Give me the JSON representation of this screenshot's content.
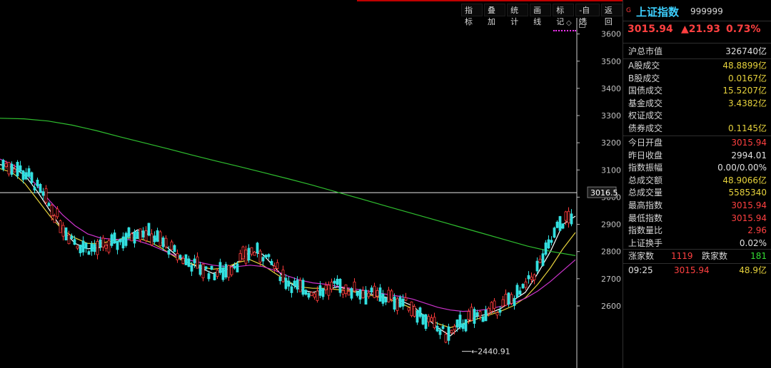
{
  "toolbar": [
    "指标",
    "叠加",
    "统计",
    "画线",
    "标记",
    "-自选",
    "返回"
  ],
  "chart_data": {
    "type": "candlestick",
    "y_axis_ticks": [
      3600,
      3500,
      3400,
      3300,
      3200,
      3100,
      3000,
      2900,
      2800,
      2700,
      2600
    ],
    "ylim": [
      2440,
      3620
    ],
    "crosshair_value": "3016.5",
    "low_annotation": "2440.91",
    "ma_series": [
      {
        "color": "#ffffff",
        "values": [
          3120,
          3110,
          3080,
          3020,
          2950,
          2880,
          2830,
          2810,
          2815,
          2830,
          2850,
          2880,
          2860,
          2830,
          2790,
          2760,
          2740,
          2720,
          2730,
          2760,
          2800,
          2790,
          2740,
          2690,
          2660,
          2650,
          2660,
          2670,
          2660,
          2650,
          2640,
          2630,
          2620,
          2600,
          2560,
          2520,
          2490,
          2530,
          2560,
          2570,
          2590,
          2620,
          2650,
          2720,
          2800,
          2900,
          2930
        ]
      },
      {
        "color": "#e6d23c",
        "values": [
          3105,
          3090,
          3050,
          2990,
          2930,
          2880,
          2850,
          2830,
          2830,
          2840,
          2850,
          2850,
          2835,
          2810,
          2780,
          2760,
          2745,
          2735,
          2740,
          2760,
          2770,
          2750,
          2720,
          2690,
          2670,
          2665,
          2665,
          2660,
          2655,
          2645,
          2635,
          2625,
          2610,
          2590,
          2560,
          2535,
          2520,
          2535,
          2550,
          2565,
          2580,
          2600,
          2630,
          2680,
          2740,
          2810,
          2870
        ]
      },
      {
        "color": "#cc33cc",
        "values": [
          3140,
          3120,
          3090,
          3040,
          2985,
          2935,
          2895,
          2865,
          2850,
          2845,
          2845,
          2840,
          2825,
          2805,
          2785,
          2770,
          2760,
          2750,
          2745,
          2745,
          2750,
          2745,
          2730,
          2710,
          2695,
          2685,
          2680,
          2672,
          2665,
          2658,
          2650,
          2642,
          2635,
          2625,
          2610,
          2595,
          2585,
          2580,
          2582,
          2588,
          2598,
          2610,
          2628,
          2655,
          2690,
          2730,
          2770
        ]
      },
      {
        "color": "#2fbf2f",
        "values": [
          3290,
          3288,
          3280,
          3265,
          3245,
          3222,
          3200,
          3178,
          3155,
          3133,
          3112,
          3090,
          3068,
          3045,
          3020,
          2995,
          2970,
          2945,
          2920,
          2895,
          2870,
          2845,
          2820,
          2800,
          2785
        ]
      }
    ]
  },
  "panel": {
    "flag": "G",
    "name": "上证指数",
    "code": "999999",
    "price": "3015.94",
    "change": "▲21.93",
    "change_pct": "0.73%",
    "market_cap": {
      "label": "沪总市值",
      "value": "326740亿"
    },
    "turnover": [
      {
        "label": "A股成交",
        "value": "48.8899亿"
      },
      {
        "label": "B股成交",
        "value": "0.0167亿"
      },
      {
        "label": "国债成交",
        "value": "15.5207亿"
      },
      {
        "label": "基金成交",
        "value": "3.4382亿"
      },
      {
        "label": "权证成交",
        "value": ""
      },
      {
        "label": "债券成交",
        "value": "0.1145亿"
      }
    ],
    "stats": [
      {
        "label": "今日开盘",
        "value": "3015.94"
      },
      {
        "label": "昨日收盘",
        "value": "2994.01"
      },
      {
        "label": "指数振幅",
        "value": "0.00/0.00%"
      },
      {
        "label": "总成交额",
        "value": "48.9066亿"
      },
      {
        "label": "总成交量",
        "value": "5585340"
      },
      {
        "label": "最高指数",
        "value": "3015.94"
      },
      {
        "label": "最低指数",
        "value": "3015.94"
      },
      {
        "label": "指数量比",
        "value": "2.96"
      },
      {
        "label": "上证换手",
        "value": "0.02%"
      }
    ],
    "breadth": {
      "up_label": "涨家数",
      "up": "1119",
      "down_label": "跌家数",
      "down": "181"
    },
    "tick": {
      "time": "09:25",
      "price": "3015.94",
      "volume": "48.9亿"
    },
    "colors": {
      "up": "#ff4040",
      "down": "#33e0e0",
      "name": "#3dd0ff",
      "yellow": "#e6d23c"
    }
  }
}
